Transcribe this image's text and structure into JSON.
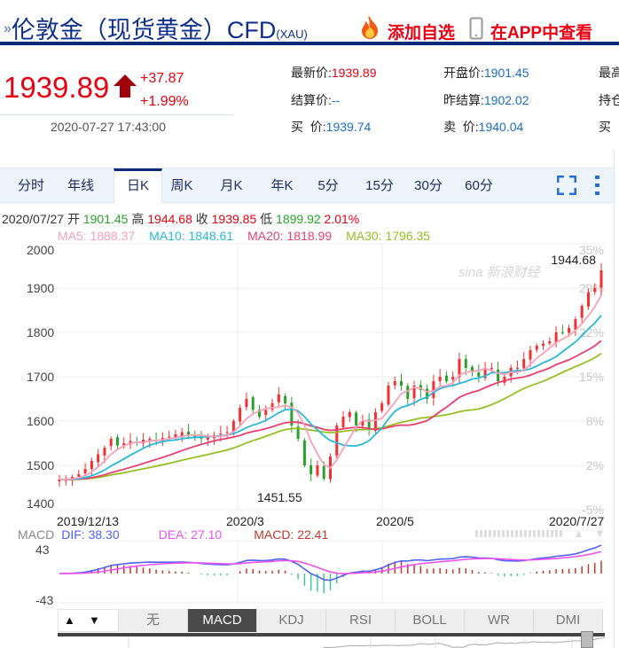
{
  "header": {
    "chevron": "»",
    "title": "伦敦金（现货黄金）CFD",
    "code": "(XAU)",
    "add_favorite": "添加自选",
    "view_in_app": "在APP中查看",
    "icons": [
      "fire-icon",
      "phone-icon"
    ]
  },
  "quote": {
    "price": "1939.89",
    "change": "+37.87",
    "change_pct": "+1.99%",
    "timestamp": "2020-07-27 17:43:00",
    "direction": "up"
  },
  "info": [
    {
      "label": "最新价:",
      "value": "1939.89",
      "color": "red"
    },
    {
      "label": "开盘价:",
      "value": "1901.45"
    },
    {
      "label": "最高"
    },
    {
      "label": "结算价:",
      "value": "--"
    },
    {
      "label": "昨结算:",
      "value": "1902.02"
    },
    {
      "label": "持仓"
    },
    {
      "label": "买  价:",
      "value": "1939.74"
    },
    {
      "label": "卖  价:",
      "value": "1940.04"
    },
    {
      "label": "买"
    }
  ],
  "tabs": [
    "分时",
    "年线",
    "日K",
    "周K",
    "月K",
    "年K",
    "5分",
    "15分",
    "30分",
    "60分"
  ],
  "active_tab": "日K",
  "ohlc": {
    "date": "2020/07/27",
    "open_label": "开",
    "open": "1901.45",
    "high_label": "高",
    "high": "1944.68",
    "close_label": "收",
    "close": "1939.85",
    "low_label": "低",
    "low": "1899.92",
    "pct": "2.01%"
  },
  "ma": {
    "ma5": "MA5: 1888.37",
    "ma10": "MA10: 1848.61",
    "ma20": "MA20: 1818.99",
    "ma30": "MA30: 1796.35"
  },
  "colors": {
    "up": "#f23030",
    "down": "#2aa22a",
    "ma5": "#f7a1bb",
    "ma10": "#27b9da",
    "ma20": "#ea3f6f",
    "ma30": "#95c022",
    "dif": "#4e62f0",
    "dea": "#ef52ef",
    "accent": "#0d2a7a"
  },
  "watermark": "sina 新浪财经",
  "chart_data": {
    "type": "candlestick",
    "ylim": [
      1400,
      2000
    ],
    "y_ticks": [
      "2000",
      "1900",
      "1800",
      "1700",
      "1600",
      "1500",
      "1400"
    ],
    "y_ticks_right": [
      "35%",
      "29%",
      "22%",
      "15%",
      "8%",
      "2%",
      "-5%"
    ],
    "x_ticks": [
      "2019/12/13",
      "2020/3",
      "2020/5",
      "2020/7/27"
    ],
    "max_label": "1944.68",
    "min_label": "1451.55",
    "closes": [
      1468,
      1470,
      1474,
      1480,
      1492,
      1510,
      1525,
      1540,
      1560,
      1545,
      1550,
      1555,
      1552,
      1558,
      1560,
      1556,
      1562,
      1565,
      1570,
      1575,
      1568,
      1565,
      1560,
      1564,
      1568,
      1572,
      1575,
      1600,
      1630,
      1650,
      1625,
      1610,
      1625,
      1640,
      1660,
      1640,
      1590,
      1560,
      1500,
      1480,
      1500,
      1470,
      1520,
      1590,
      1610,
      1620,
      1590,
      1600,
      1580,
      1620,
      1640,
      1680,
      1690,
      1680,
      1650,
      1680,
      1670,
      1650,
      1690,
      1700,
      1690,
      1700,
      1740,
      1720,
      1710,
      1700,
      1720,
      1720,
      1690,
      1700,
      1720,
      1720,
      1740,
      1760,
      1770,
      1775,
      1780,
      1800,
      1800,
      1810,
      1830,
      1860,
      1890,
      1900,
      1940
    ]
  },
  "macd": {
    "label": "MACD",
    "dif": "DIF: 38.30",
    "dea": "DEA: 27.10",
    "macd": "MACD: 22.41",
    "top": "43",
    "bottom": "-43"
  },
  "indicators": [
    "无",
    "MACD",
    "KDJ",
    "RSI",
    "BOLL",
    "WR",
    "DMI"
  ],
  "active_indicator": "MACD",
  "arrows": {
    "up": "▲",
    "down": "▼"
  }
}
